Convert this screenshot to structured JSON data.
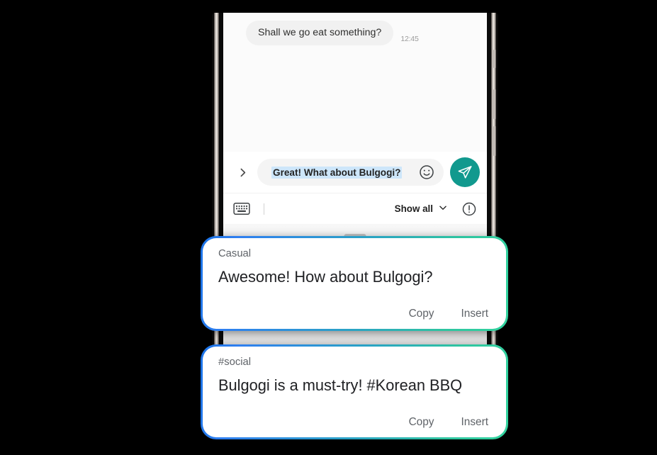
{
  "device": {
    "name": "smartphone-frame",
    "side_buttons": [
      "volume-up",
      "volume-down",
      "power"
    ]
  },
  "conversation": {
    "messages": [
      {
        "sender": "incoming",
        "text": "Shall we go eat something?",
        "time": "12:45"
      }
    ]
  },
  "input_bar": {
    "expand_icon": "chevron-right-icon",
    "draft_text": "Great! What about Bulgogi?",
    "draft_selected": true,
    "emoji_icon": "emoji-smiley-icon",
    "send_icon": "send-paper-plane-icon",
    "send_button_color": "#11998e",
    "selection_color": "#cde6fa"
  },
  "suggestion_toolbar": {
    "keyboard_icon": "keyboard-icon",
    "show_all_label": "Show all",
    "show_all_chevron": "chevron-down-icon",
    "info_icon": "info-exclamation-circle-icon"
  },
  "suggestion_cards": [
    {
      "tag": "Casual",
      "text": "Awesome! How about Bulgogi?",
      "actions": [
        "Copy",
        "Insert"
      ],
      "border_gradient_start": "#1a73e8",
      "border_gradient_end": "#33d49f"
    },
    {
      "tag": "#social",
      "text": "Bulgogi is a must-try! #Korean BBQ",
      "actions": [
        "Copy",
        "Insert"
      ],
      "border_gradient_start": "#1a73e8",
      "border_gradient_end": "#33d49f"
    }
  ]
}
